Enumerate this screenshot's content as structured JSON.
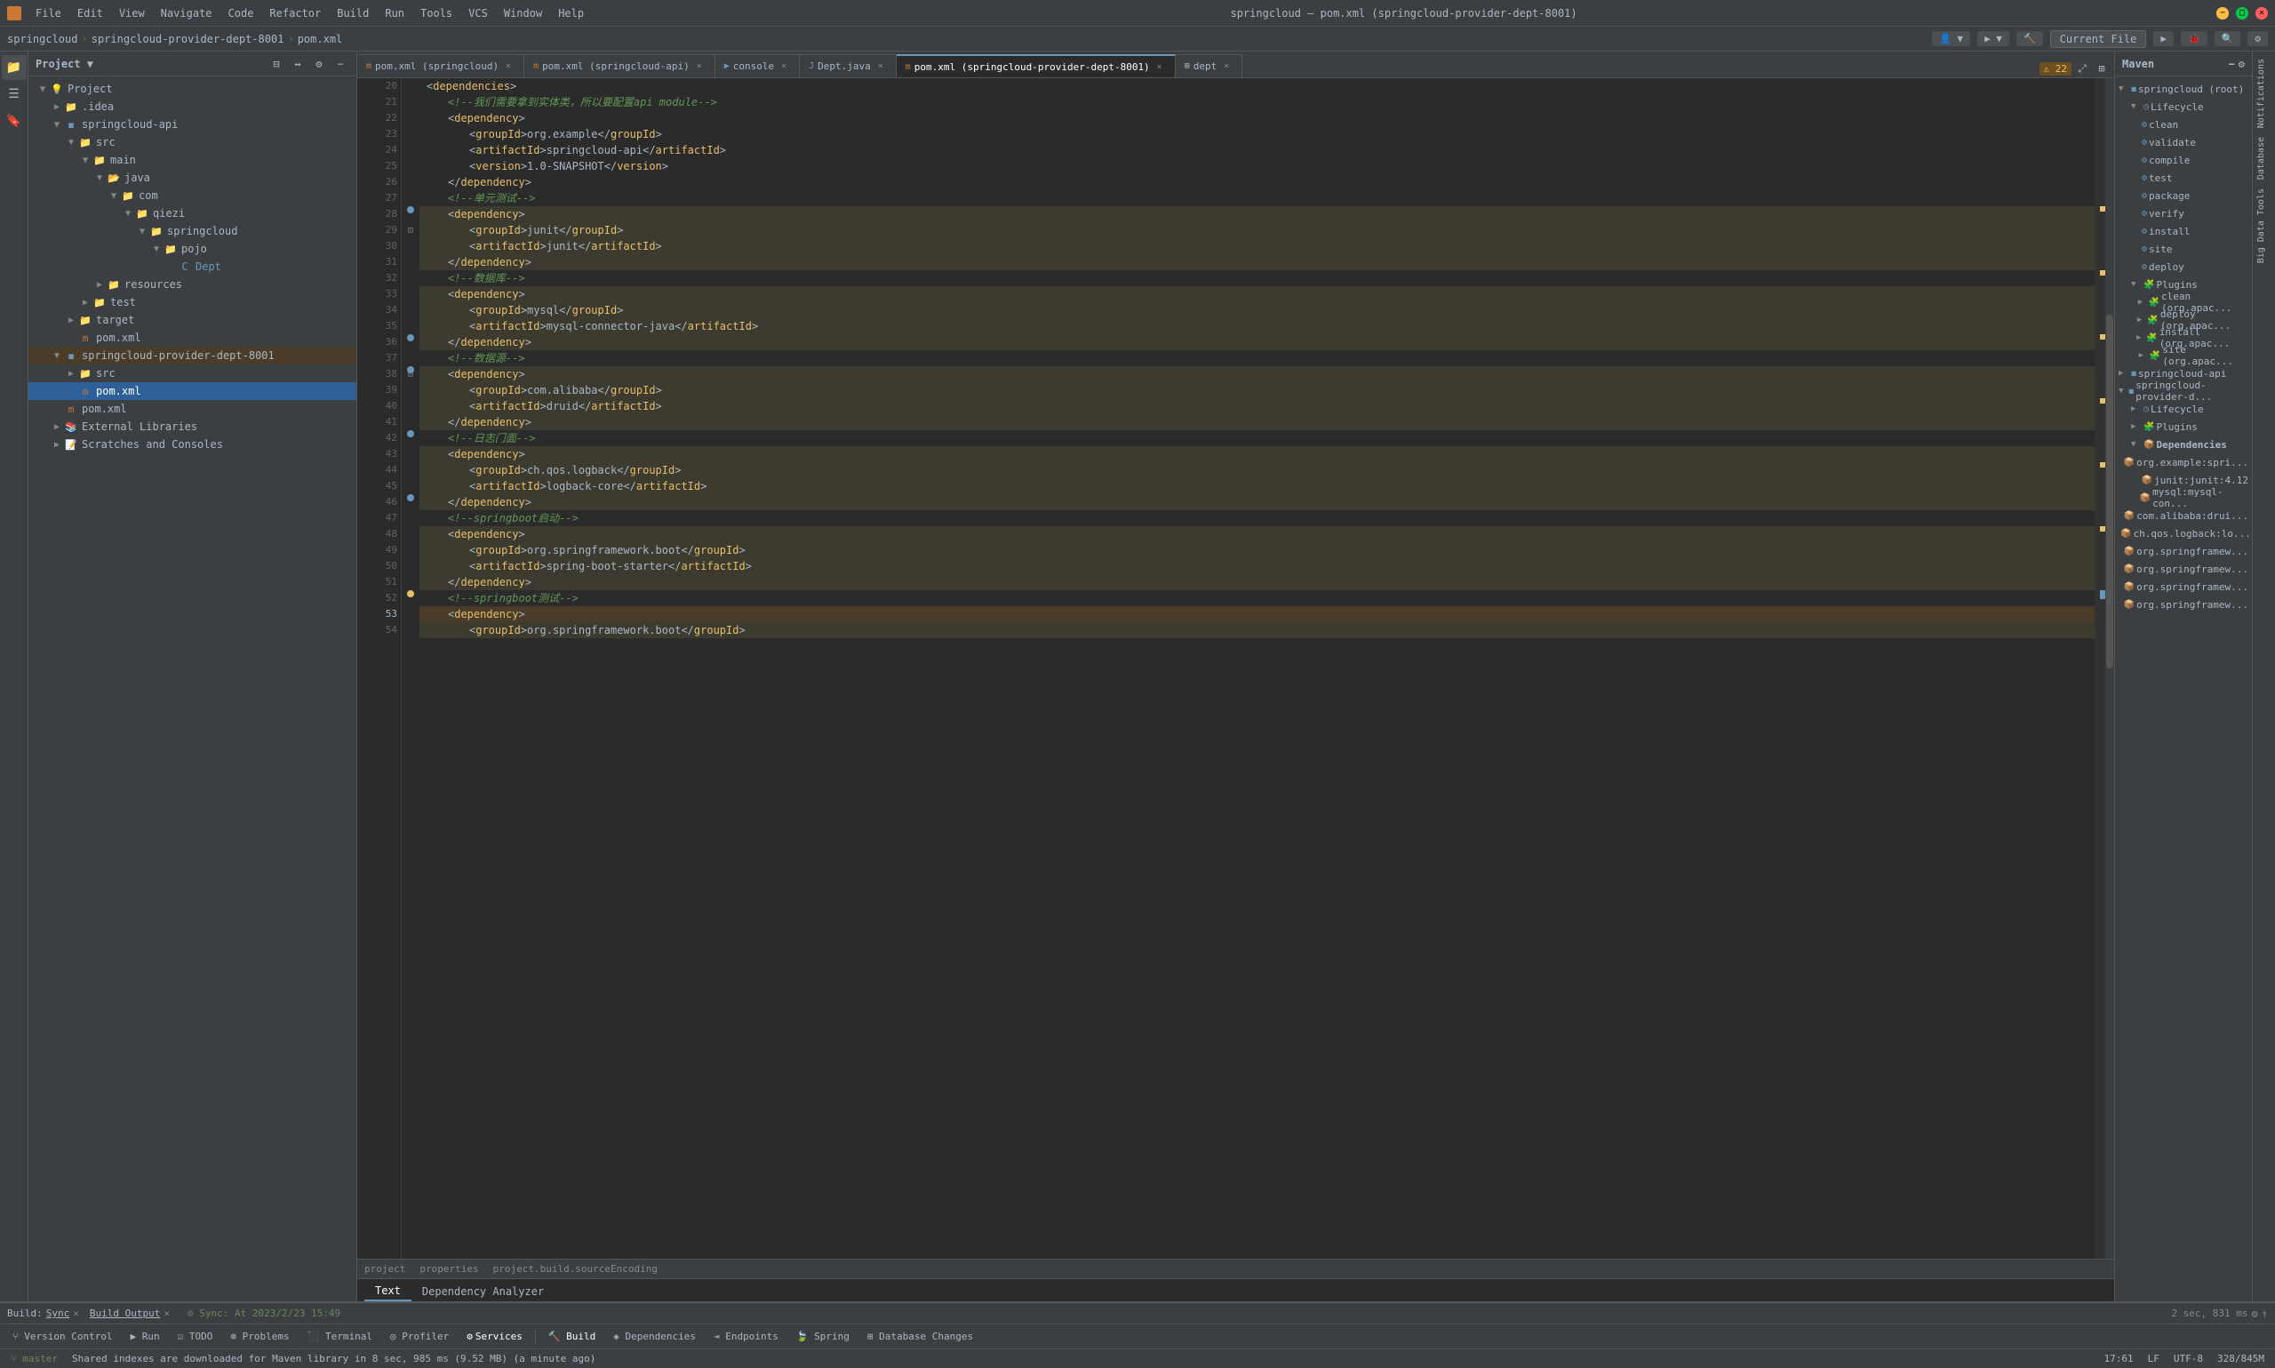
{
  "app": {
    "title": "springcloud – pom.xml (springcloud-provider-dept-8001)",
    "icon": "🔴"
  },
  "menubar": {
    "items": [
      "File",
      "Edit",
      "View",
      "Navigate",
      "Code",
      "Refactor",
      "Build",
      "Run",
      "Tools",
      "VCS",
      "Window",
      "Help"
    ]
  },
  "breadcrumb": {
    "items": [
      "springcloud",
      "springcloud-provider-dept-8001",
      "pom.xml"
    ]
  },
  "toolbar": {
    "currentFile": "Current File",
    "currentFileDropdown": "▼"
  },
  "tabs": [
    {
      "label": "pom.xml (springcloud)",
      "icon": "m",
      "active": false,
      "closable": true
    },
    {
      "label": "pom.xml (springcloud-api)",
      "icon": "m",
      "active": false,
      "closable": true
    },
    {
      "label": "console",
      "icon": "▶",
      "active": false,
      "closable": true
    },
    {
      "label": "Dept.java",
      "icon": "J",
      "active": false,
      "closable": true
    },
    {
      "label": "pom.xml (springcloud-provider-dept-8001)",
      "icon": "m",
      "active": true,
      "closable": true
    },
    {
      "label": "dept",
      "icon": "⊞",
      "active": false,
      "closable": true
    }
  ],
  "editor": {
    "filename": "pom.xml",
    "warningCount": "22",
    "lines": [
      {
        "num": 20,
        "content": "        <dependencies>",
        "type": "normal"
      },
      {
        "num": 21,
        "content": "            <!--我们需要拿到实体类，所以要配置api module-->",
        "type": "normal"
      },
      {
        "num": 22,
        "content": "            <dependency>",
        "type": "normal"
      },
      {
        "num": 23,
        "content": "                <groupId>org.example</groupId>",
        "type": "normal"
      },
      {
        "num": 24,
        "content": "                <artifactId>springcloud-api</artifactId>",
        "type": "normal"
      },
      {
        "num": 25,
        "content": "                <version>1.0-SNAPSHOT</version>",
        "type": "normal"
      },
      {
        "num": 26,
        "content": "            </dependency>",
        "type": "normal"
      },
      {
        "num": 27,
        "content": "            <!--单元测试-->",
        "type": "normal"
      },
      {
        "num": 28,
        "content": "            <dependency>",
        "type": "highlighted",
        "hasMarker": true
      },
      {
        "num": 29,
        "content": "                <groupId>junit</groupId>",
        "type": "highlighted"
      },
      {
        "num": 30,
        "content": "                <artifactId>junit</artifactId>",
        "type": "highlighted"
      },
      {
        "num": 31,
        "content": "            </dependency>",
        "type": "highlighted"
      },
      {
        "num": 32,
        "content": "            <!--数据库-->",
        "type": "normal"
      },
      {
        "num": 33,
        "content": "            <dependency>",
        "type": "highlighted",
        "hasMarker": true
      },
      {
        "num": 34,
        "content": "                <groupId>mysql</groupId>",
        "type": "highlighted"
      },
      {
        "num": 35,
        "content": "                <artifactId>mysql-connector-java</artifactId>",
        "type": "highlighted"
      },
      {
        "num": 36,
        "content": "            </dependency>",
        "type": "highlighted"
      },
      {
        "num": 37,
        "content": "            <!--数据源-->",
        "type": "normal"
      },
      {
        "num": 38,
        "content": "            <dependency>",
        "type": "highlighted",
        "hasMarker": true
      },
      {
        "num": 39,
        "content": "                <groupId>com.alibaba</groupId>",
        "type": "highlighted"
      },
      {
        "num": 40,
        "content": "                <artifactId>druid</artifactId>",
        "type": "highlighted"
      },
      {
        "num": 41,
        "content": "            </dependency>",
        "type": "highlighted"
      },
      {
        "num": 42,
        "content": "            <!--日志门面-->",
        "type": "normal"
      },
      {
        "num": 43,
        "content": "            <dependency>",
        "type": "highlighted",
        "hasMarker": true
      },
      {
        "num": 44,
        "content": "                <groupId>ch.qos.logback</groupId>",
        "type": "highlighted"
      },
      {
        "num": 45,
        "content": "                <artifactId>logback-core</artifactId>",
        "type": "highlighted"
      },
      {
        "num": 46,
        "content": "            </dependency>",
        "type": "highlighted"
      },
      {
        "num": 47,
        "content": "            <!--springboot启动-->",
        "type": "normal"
      },
      {
        "num": 48,
        "content": "            <dependency>",
        "type": "highlighted",
        "hasMarker": true
      },
      {
        "num": 49,
        "content": "                <groupId>org.springframework.boot</groupId>",
        "type": "highlighted"
      },
      {
        "num": 50,
        "content": "                <artifactId>spring-boot-starter</artifactId>",
        "type": "highlighted"
      },
      {
        "num": 51,
        "content": "            </dependency>",
        "type": "highlighted"
      },
      {
        "num": 52,
        "content": "            <!--springboot测试-->",
        "type": "normal"
      },
      {
        "num": 53,
        "content": "            <dependency>",
        "type": "highlighted",
        "hasMarker": true
      },
      {
        "num": 54,
        "content": "                <groupId>org.springframework.boot</groupId>",
        "type": "highlighted"
      }
    ],
    "bottomTabs": [
      "project",
      "properties",
      "project.build.sourceEncoding"
    ],
    "editorTabs": [
      "Text",
      "Dependency Analyzer"
    ]
  },
  "projectTree": {
    "title": "Project",
    "items": [
      {
        "label": "Project",
        "level": 0,
        "type": "dropdown",
        "expanded": true
      },
      {
        "label": ".idea",
        "level": 1,
        "type": "folder",
        "expanded": false
      },
      {
        "label": "springcloud-api",
        "level": 1,
        "type": "module",
        "expanded": true
      },
      {
        "label": "src",
        "level": 2,
        "type": "folder",
        "expanded": true
      },
      {
        "label": "main",
        "level": 3,
        "type": "folder",
        "expanded": true
      },
      {
        "label": "java",
        "level": 4,
        "type": "folder",
        "expanded": true
      },
      {
        "label": "com",
        "level": 5,
        "type": "folder",
        "expanded": true
      },
      {
        "label": "qiezi",
        "level": 6,
        "type": "folder",
        "expanded": true
      },
      {
        "label": "springcloud",
        "level": 7,
        "type": "folder",
        "expanded": true
      },
      {
        "label": "pojo",
        "level": 8,
        "type": "folder",
        "expanded": true
      },
      {
        "label": "Dept",
        "level": 9,
        "type": "class",
        "expanded": false
      },
      {
        "label": "resources",
        "level": 4,
        "type": "folder",
        "expanded": false
      },
      {
        "label": "test",
        "level": 2,
        "type": "folder",
        "expanded": false
      },
      {
        "label": "target",
        "level": 2,
        "type": "folder",
        "expanded": false
      },
      {
        "label": "pom.xml",
        "level": 2,
        "type": "xml",
        "expanded": false
      },
      {
        "label": "springcloud-provider-dept-8001",
        "level": 1,
        "type": "module",
        "expanded": true,
        "selected": true
      },
      {
        "label": "src",
        "level": 2,
        "type": "folder",
        "expanded": false
      },
      {
        "label": "pom.xml",
        "level": 2,
        "type": "xml",
        "expanded": false,
        "selected": true
      },
      {
        "label": "pom.xml",
        "level": 1,
        "type": "xml",
        "expanded": false
      },
      {
        "label": "External Libraries",
        "level": 1,
        "type": "folder",
        "expanded": false
      },
      {
        "label": "Scratches and Consoles",
        "level": 1,
        "type": "folder",
        "expanded": false
      }
    ]
  },
  "maven": {
    "title": "Maven",
    "springcloudRoot": "springcloud (root)",
    "lifecycle": "Lifecycle",
    "lifecycleItems": [
      "clean",
      "validate",
      "compile",
      "test",
      "package",
      "verify",
      "install",
      "site",
      "deploy"
    ],
    "plugins": "Plugins",
    "pluginItems": [
      "clean (org.apac...",
      "deploy (org.apac...",
      "install (org.apac...",
      "site (org.apac..."
    ],
    "springcloudApi": "springcloud-api",
    "springcloudProvider": "springcloud-provider-d...",
    "providerLifecycle": "Lifecycle",
    "providerPlugins": "Plugins",
    "providerDeps": "Dependencies",
    "depItems": [
      "org.example:spri...",
      "junit:junit:4.12",
      "mysql:mysql-con...",
      "com.alibaba:drui...",
      "ch.qos.logback:lo...",
      "org.springframew...",
      "org.springframew...",
      "org.springframew...",
      "org.springframew..."
    ]
  },
  "bottomBar": {
    "build": "Build:",
    "sync": "Sync",
    "syncClose": "×",
    "buildOutput": "Build Output",
    "buildOutputClose": "×",
    "statusSync": "⊙ Sync: At 2023/2/23 15:49",
    "time": "2 sec, 831 ms",
    "bottomIcons": [
      "⚙",
      "↓"
    ]
  },
  "statusToolbar": {
    "versionControl": "Version Control",
    "run": "▶ Run",
    "todo": "☑ TODO",
    "problems": "⊗ Problems",
    "terminal": "⬛ Terminal",
    "profiler": "◎ Profiler",
    "services": "Services",
    "build": "⚙ Build",
    "dependencies": "◈ Dependencies",
    "endpoints": "⇥ Endpoints",
    "spring": "🍃 Spring",
    "dbChanges": "⊞ Database Changes"
  },
  "statusBar": {
    "message": "Shared indexes are downloaded for Maven library in 8 sec, 985 ms (9.52 MB) (a minute ago)",
    "cursor": "17:61",
    "encoding": "LF",
    "charset": "UTF-8",
    "memory": "328/845M"
  }
}
